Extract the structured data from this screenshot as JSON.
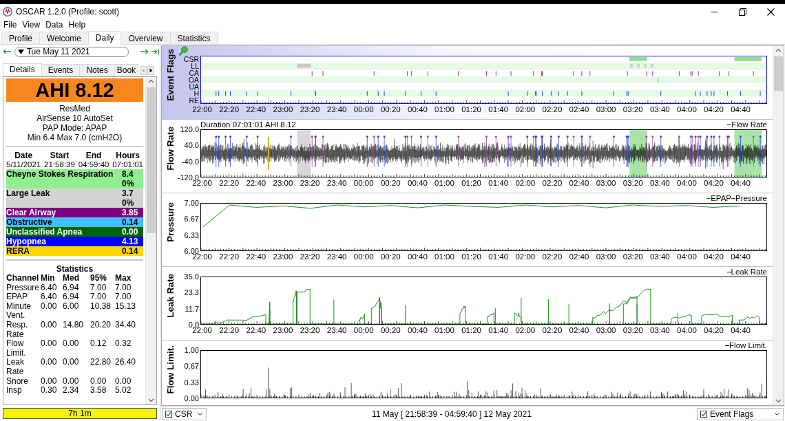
{
  "window": {
    "title": "OSCAR 1.2.0 (Profile: scott)"
  },
  "menu": [
    "File",
    "View",
    "Data",
    "Help"
  ],
  "tabs": [
    {
      "label": "Profile",
      "selected": false
    },
    {
      "label": "Welcome",
      "selected": false
    },
    {
      "label": "Daily",
      "selected": true
    },
    {
      "label": "Overview",
      "selected": false
    },
    {
      "label": "Statistics",
      "selected": false
    }
  ],
  "date_nav": {
    "date": "Tue May 11 2021"
  },
  "side_tabs": [
    {
      "label": "Details",
      "selected": true
    },
    {
      "label": "Events",
      "selected": false
    },
    {
      "label": "Notes",
      "selected": false
    },
    {
      "label": "Book",
      "selected": false
    }
  ],
  "details": {
    "ahi": "AHI 8.12",
    "device_lines": [
      "ResMed",
      "AirSense 10 AutoSet",
      "PAP Mode: APAP",
      "Min 6.4 Max 7.0 (cmH2O)"
    ],
    "session_columns": [
      "Date",
      "Start",
      "End",
      "Hours"
    ],
    "session_row": [
      "5/11/2021",
      "21:58:39",
      "04:59:40",
      "07:01:01"
    ],
    "events": [
      {
        "name": "Cheyne Stokes Respiration",
        "value": "8.40%",
        "color": "#90ee90"
      },
      {
        "name": "Large Leak",
        "value": "3.70%",
        "color": "#d3d3d3"
      },
      {
        "name": "Clear Airway",
        "value": "3.85",
        "color": "#800080"
      },
      {
        "name": "Obstructive",
        "value": "0.14",
        "color": "#40c0ff"
      },
      {
        "name": "Unclassified Apnea",
        "value": "0.00",
        "color": "#006400"
      },
      {
        "name": "Hypopnea",
        "value": "4.13",
        "color": "#0000ff"
      },
      {
        "name": "RERA",
        "value": "0.14",
        "color": "#ffd700"
      }
    ],
    "statistics_title": "Statistics",
    "statistics_columns": [
      "Channel",
      "Min",
      "Med",
      "95%",
      "Max"
    ],
    "statistics_rows": [
      [
        "Pressure",
        "6.40",
        "6.94",
        "7.00",
        "7.00"
      ],
      [
        "EPAP",
        "6.40",
        "6.94",
        "7.00",
        "7.00"
      ],
      [
        "Minute Vent.",
        "0.00",
        "6.00",
        "10.38",
        "15.13"
      ],
      [
        "Resp. Rate",
        "0.00",
        "14.80",
        "20.20",
        "34.40"
      ],
      [
        "Flow Limit.",
        "0.00",
        "0.00",
        "0.12",
        "0.32"
      ],
      [
        "Leak Rate",
        "0.00",
        "0.00",
        "22.80",
        "26.40"
      ],
      [
        "Snore",
        "0.00",
        "0.00",
        "0.00",
        "0.00"
      ],
      [
        "Insp",
        "0.30",
        "2.34",
        "3.58",
        "5.02"
      ]
    ]
  },
  "summary_bar": "7h 1m",
  "graphs": [
    {
      "kind": "flags",
      "title": "Event Flags",
      "y_ticks": [
        "CSR",
        "LL",
        "CA",
        "OA",
        "UA",
        "H",
        "RE"
      ],
      "x_ticks": [
        "22:00",
        "22:20",
        "22:40",
        "23:00",
        "23:20",
        "23:40",
        "00:00",
        "00:20",
        "00:40",
        "01:00",
        "01:20",
        "01:40",
        "02:00",
        "02:20",
        "02:40",
        "03:00",
        "03:20",
        "03:40",
        "04:00",
        "04:20",
        "04:40"
      ]
    },
    {
      "kind": "flow",
      "title": "Flow Rate",
      "header": "Duration 07:01:01 AHI 8.12",
      "legend": [
        {
          "label": "Flow Rate",
          "color": "#000000"
        }
      ],
      "y_ticks": [
        "120.0",
        "40.0",
        "-40.0",
        "-120.0"
      ],
      "x_ticks": [
        "22:00",
        "22:20",
        "22:40",
        "23:00",
        "23:20",
        "23:40",
        "00:00",
        "00:20",
        "00:40",
        "01:00",
        "01:20",
        "01:40",
        "02:00",
        "02:20",
        "02:40",
        "03:00",
        "03:20",
        "03:40",
        "04:00",
        "04:20",
        "04:40"
      ]
    },
    {
      "kind": "pressure",
      "chart_data": {
        "type": "line",
        "ylabel": "Pressure",
        "ylim": [
          6,
          7
        ],
        "yticks": [
          {
            "value": 7,
            "label": "7.00"
          },
          {
            "value": 6.67,
            "label": "6.67"
          },
          {
            "value": 6.33,
            "label": "6.33"
          },
          {
            "value": 6,
            "label": "6.00"
          }
        ],
        "categories": [
          "22:00",
          "22:20",
          "22:40",
          "23:00",
          "23:20",
          "23:40",
          "00:00",
          "00:20",
          "00:40",
          "01:00",
          "01:20",
          "01:40",
          "02:00",
          "02:20",
          "02:40",
          "03:00",
          "03:20",
          "03:40",
          "04:00",
          "04:20",
          "04:40"
        ],
        "series": [
          {
            "name": "EPAP",
            "color": "#008000",
            "values": [
              6.5,
              6.97,
              6.92,
              6.95,
              6.9,
              6.97,
              6.93,
              6.96,
              6.91,
              6.97,
              6.94,
              6.92,
              6.97,
              6.93,
              6.96,
              6.91,
              6.97,
              6.94,
              6.96,
              6.92,
              6.95
            ]
          },
          {
            "name": "Pressure",
            "color": "#ff0000",
            "values": [
              null,
              null,
              null,
              null,
              null,
              null,
              null,
              null,
              null,
              null,
              null,
              null,
              null,
              null,
              null,
              null,
              null,
              null,
              null,
              null,
              null
            ]
          }
        ]
      }
    },
    {
      "kind": "leak",
      "title": "Leak Rate",
      "legend": [
        {
          "label": "Leak Rate",
          "color": "#000000"
        }
      ],
      "y_ticks": [
        "35.0",
        "23.3",
        "11.7",
        "0.0"
      ],
      "x_ticks": [
        "22:00",
        "22:20",
        "22:40",
        "23:00",
        "23:20",
        "23:40",
        "00:00",
        "00:20",
        "00:40",
        "01:00",
        "01:20",
        "01:40",
        "02:00",
        "02:20",
        "02:40",
        "03:00",
        "03:20",
        "03:40",
        "04:00",
        "04:20",
        "04:40"
      ]
    },
    {
      "kind": "bars",
      "title": "Flow Limit.",
      "legend": [
        {
          "label": "Flow Limit.",
          "color": "#000000"
        }
      ],
      "y_ticks": [
        "1.00",
        "0.67",
        "0.33",
        "0.00"
      ]
    }
  ],
  "footer": {
    "left_combo": {
      "label": "CSR",
      "checked": true
    },
    "range": "11 May [ 21:58:39 - 04:59:40 ] 12 May 2021",
    "right_combo": {
      "label": "Event Flags",
      "checked": true
    }
  }
}
